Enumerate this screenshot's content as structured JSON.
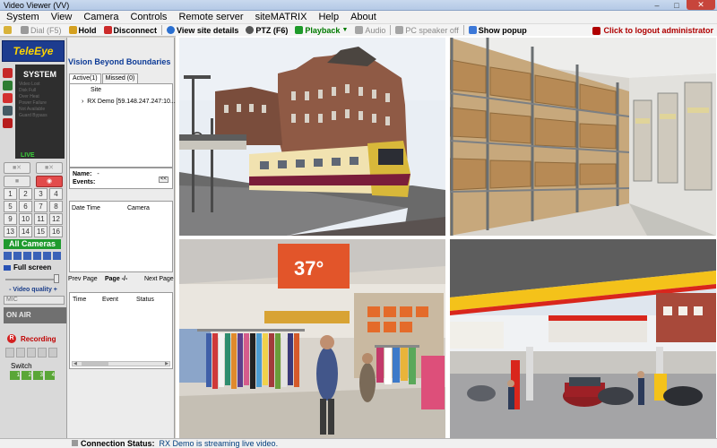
{
  "window": {
    "title": "Video Viewer (VV)"
  },
  "menu": [
    {
      "label": "System"
    },
    {
      "label": "View"
    },
    {
      "label": "Camera"
    },
    {
      "label": "Controls"
    },
    {
      "label": "Remote server"
    },
    {
      "label": "siteMATRIX"
    },
    {
      "label": "Help"
    },
    {
      "label": "About"
    }
  ],
  "toolbar": {
    "dial": "Dial (F5)",
    "hold": "Hold",
    "disconnect": "Disconnect",
    "view_site_details": "View site details",
    "ptz": "PTZ (F6)",
    "playback": "Playback",
    "audio": "Audio",
    "pc_speaker": "PC speaker off",
    "show_popup": "Show popup",
    "logout": "Click to logout administrator"
  },
  "sidebar": {
    "logo": "TeleEye",
    "system_title": "SYSTEM",
    "system_items": [
      "Video Lost",
      "Disk Full",
      "Over Heat",
      "Power Failure",
      "Not Available",
      "Guard Bypass"
    ],
    "live": "LIVE",
    "camera_numbers": [
      "1",
      "2",
      "3",
      "4",
      "5",
      "6",
      "7",
      "8",
      "9",
      "10",
      "11",
      "12",
      "13",
      "14",
      "15",
      "16"
    ],
    "all_cameras": "All Cameras",
    "full_screen": "Full screen",
    "video_quality": "- Video quality +",
    "mic": "MIC",
    "on_air": "ON AIR",
    "recording": "Recording",
    "switch_label": "Switch",
    "switch_items": [
      "1",
      "2",
      "3",
      "4"
    ]
  },
  "midpanel": {
    "tagline": "Vision Beyond Boundaries",
    "tabs": [
      {
        "label": "Active(1)"
      },
      {
        "label": "Missed (0)"
      }
    ],
    "site_header": "Site",
    "site_row": "RX Demo [59.148.247.247:10...",
    "name_label": "Name:",
    "name_value": "-",
    "events_label": "Events:",
    "events_btn": "<<",
    "events_table": {
      "columns": [
        "Date Time",
        "Camera"
      ]
    },
    "pager": {
      "prev": "Prev Page",
      "page": "Page -/-",
      "next": "Next Page"
    },
    "log_table": {
      "columns": [
        "Time",
        "Event",
        "Status"
      ]
    }
  },
  "status": {
    "label": "Connection Status:",
    "text": "RX Demo is streaming live video."
  },
  "colors": {
    "tagline": "#0c3a96",
    "logout": "#b00000",
    "all_cameras": "#1f9a2e",
    "recording": "#c00000",
    "system_panel": "#2e2e2e"
  }
}
